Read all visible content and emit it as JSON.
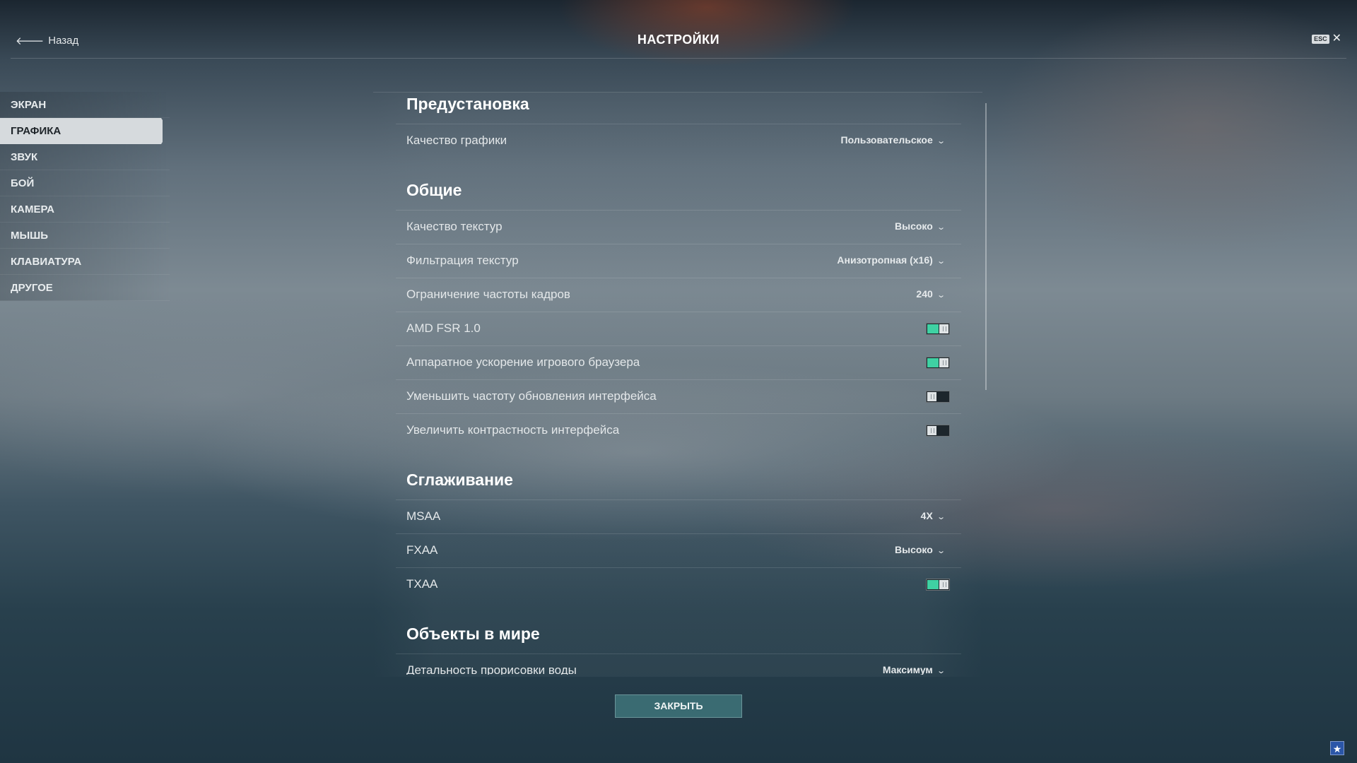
{
  "header": {
    "back_label": "Назад",
    "back_icon": "arrow-left-icon",
    "title": "НАСТРОЙКИ",
    "esc_label": "ESC",
    "close_symbol": "✕"
  },
  "sidebar": {
    "items": [
      {
        "label": "ЭКРАН",
        "active": false
      },
      {
        "label": "ГРАФИКА",
        "active": true
      },
      {
        "label": "ЗВУК",
        "active": false
      },
      {
        "label": "БОЙ",
        "active": false
      },
      {
        "label": "КАМЕРА",
        "active": false
      },
      {
        "label": "МЫШЬ",
        "active": false
      },
      {
        "label": "КЛАВИАТУРА",
        "active": false
      },
      {
        "label": "ДРУГОЕ",
        "active": false
      }
    ]
  },
  "sections": {
    "preset": {
      "title": "Предустановка",
      "graphics_quality": {
        "label": "Качество графики",
        "value": "Пользовательское"
      }
    },
    "general": {
      "title": "Общие",
      "texture_quality": {
        "label": "Качество текстур",
        "value": "Высоко"
      },
      "texture_filtering": {
        "label": "Фильтрация текстур",
        "value": "Анизотропная (x16)"
      },
      "fps_limit": {
        "label": "Ограничение частоты кадров",
        "value": "240"
      },
      "amd_fsr": {
        "label": "AMD FSR 1.0",
        "enabled": true
      },
      "browser_accel": {
        "label": "Аппаратное ускорение игрового браузера",
        "enabled": true
      },
      "reduce_ui_refresh": {
        "label": "Уменьшить частоту обновления интерфейса",
        "enabled": false
      },
      "ui_contrast": {
        "label": "Увеличить контрастность интерфейса",
        "enabled": false
      }
    },
    "antialiasing": {
      "title": "Сглаживание",
      "msaa": {
        "label": "MSAA",
        "value": "4X"
      },
      "fxaa": {
        "label": "FXAA",
        "value": "Высоко"
      },
      "txaa": {
        "label": "TXAA",
        "enabled": true
      }
    },
    "world_objects": {
      "title": "Объекты в мире",
      "water_detail": {
        "label": "Детальность прорисовки воды",
        "value": "Максимум"
      }
    }
  },
  "dropdown_chevron": "⌄",
  "footer": {
    "close_label": "ЗАКРЫТЬ",
    "corner_icon": "star-icon",
    "corner_symbol": "★"
  },
  "colors": {
    "toggle_on": "#3fd1a3",
    "active_tab_bg": "#d6dadd",
    "close_button_bg": "#3a6b72"
  }
}
